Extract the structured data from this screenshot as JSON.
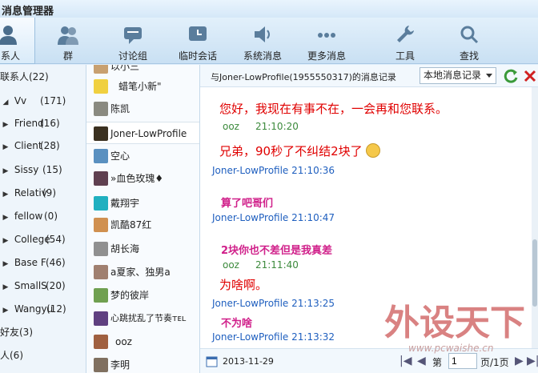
{
  "app": {
    "title": "消息管理器"
  },
  "toolbar": [
    {
      "label": "系人",
      "icon": "contact-icon"
    },
    {
      "label": "群",
      "icon": "group-icon"
    },
    {
      "label": "讨论组",
      "icon": "discussion-icon"
    },
    {
      "label": "临时会话",
      "icon": "temp-chat-icon"
    },
    {
      "label": "系统消息",
      "icon": "speaker-icon"
    },
    {
      "label": "更多消息",
      "icon": "more-icon"
    },
    {
      "label": "工具",
      "icon": "wrench-icon"
    },
    {
      "label": "查找",
      "icon": "search-icon"
    }
  ],
  "groups": [
    {
      "label": "联系人(22)",
      "arrow": ""
    },
    {
      "label": "Vv",
      "count": "(171)",
      "arrow": "◢"
    },
    {
      "label": "Friend",
      "count": "(16)",
      "arrow": "▶"
    },
    {
      "label": "Client",
      "count": "(28)",
      "arrow": "▶"
    },
    {
      "label": "Sissy",
      "count": "(15)",
      "arrow": "▶"
    },
    {
      "label": "Relativ",
      "count": "(9)",
      "arrow": "▶"
    },
    {
      "label": "fellow",
      "count": "(0)",
      "arrow": "▶"
    },
    {
      "label": "College",
      "count": "(54)",
      "arrow": "▶"
    },
    {
      "label": "Base F",
      "count": "(46)",
      "arrow": "▶"
    },
    {
      "label": "SmallS",
      "count": "(20)",
      "arrow": "▶"
    },
    {
      "label": "Wangyu",
      "count": "(12)",
      "arrow": "▶"
    },
    {
      "label": "好友(3)",
      "arrow": ""
    },
    {
      "label": "人(6)",
      "arrow": ""
    }
  ],
  "contacts": [
    {
      "name": "以小三",
      "color": "#c8a070"
    },
    {
      "name": "蜡笔小新\"",
      "color": "#f0d040"
    },
    {
      "name": "陈凯",
      "color": "#8a8a80"
    },
    {
      "name": "Joner-LowProfile",
      "color": "#3a3020"
    },
    {
      "name": "空心",
      "color": "#5a90c0"
    },
    {
      "name": "»血色玫瑰♦",
      "color": "#604050"
    },
    {
      "name": "戴翔宇",
      "color": "#20b0c0"
    },
    {
      "name": "凯酷87红",
      "color": "#d09050"
    },
    {
      "name": "胡长海",
      "color": "#909090"
    },
    {
      "name": "a夏家、独男a",
      "color": "#a08070"
    },
    {
      "name": "梦的彼岸",
      "color": "#70a050"
    },
    {
      "name": "心跳扰乱了节奏ᴛᴇʟ",
      "color": "#604080"
    },
    {
      "name": "ooz",
      "color": "#a06040"
    },
    {
      "name": "李明",
      "color": "#807060"
    }
  ],
  "history": {
    "title": "与Joner-LowProfile(1955550317)的消息记录",
    "source_option": "本地消息记录",
    "messages": [
      {
        "sender": "",
        "time": "",
        "text": "您好，我现在有事不在，一会再和您联系。",
        "side": "me",
        "color": "#e00000"
      },
      {
        "sender": "ooz",
        "time": "21:10:20",
        "text": "兄弟，90秒了不纠结2块了",
        "side": "me",
        "color": "#e00000",
        "emoji": true
      },
      {
        "sender": "Joner-LowProfile",
        "time": "21:10:36",
        "text": "算了吧哥们",
        "side": "oth",
        "color": "#d0208a"
      },
      {
        "sender": "Joner-LowProfile",
        "time": "21:10:47",
        "text": "2块你也不差但是我真差",
        "side": "oth",
        "color": "#d0208a"
      },
      {
        "sender": "ooz",
        "time": "21:11:40",
        "text": "为啥啊。",
        "side": "me",
        "color": "#e00000"
      },
      {
        "sender": "Joner-LowProfile",
        "time": "21:13:25",
        "text": "不为啥",
        "side": "oth",
        "color": "#d0208a"
      },
      {
        "sender": "Joner-LowProfile",
        "time": "21:13:32",
        "text": "",
        "side": "oth",
        "color": "#d0208a"
      }
    ],
    "date": "2013-11-29",
    "page_prefix": "第",
    "page_value": "1",
    "page_suffix": "页/1页"
  },
  "watermark": {
    "brand": "外设天下",
    "url": "www.pcwaishe.cn"
  }
}
